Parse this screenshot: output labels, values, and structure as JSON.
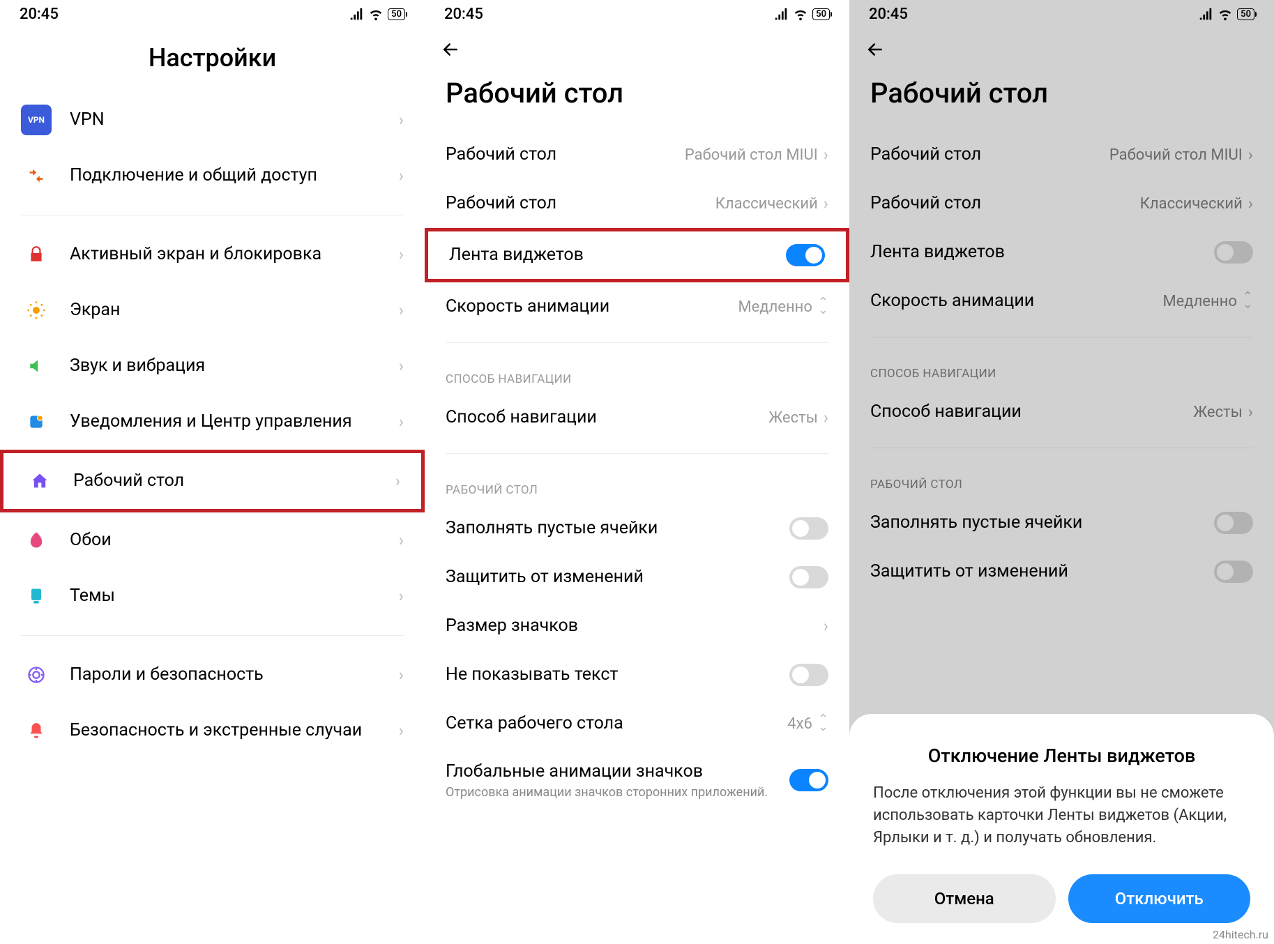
{
  "status": {
    "time": "20:45",
    "battery": "50"
  },
  "screen1": {
    "title": "Настройки",
    "items": [
      {
        "label": "VPN",
        "icon": "vpn"
      },
      {
        "label": "Подключение и общий доступ",
        "icon": "share"
      }
    ],
    "items2": [
      {
        "label": "Активный экран и блокировка",
        "icon": "lock"
      },
      {
        "label": "Экран",
        "icon": "sun"
      },
      {
        "label": "Звук и вибрация",
        "icon": "sound"
      },
      {
        "label": "Уведомления и Центр управления",
        "icon": "notif"
      },
      {
        "label": "Рабочий стол",
        "icon": "home",
        "highlight": true
      },
      {
        "label": "Обои",
        "icon": "wall"
      },
      {
        "label": "Темы",
        "icon": "theme"
      }
    ],
    "items3": [
      {
        "label": "Пароли и безопасность",
        "icon": "pass"
      },
      {
        "label": "Безопасность и экстренные случаи",
        "icon": "alert"
      }
    ]
  },
  "screen2": {
    "title": "Рабочий стол",
    "rows_top": [
      {
        "label": "Рабочий стол",
        "value": "Рабочий стол MIUI",
        "type": "link"
      },
      {
        "label": "Рабочий стол",
        "value": "Классический",
        "type": "link"
      },
      {
        "label": "Лента виджетов",
        "type": "toggle",
        "state": "on",
        "highlight": true
      },
      {
        "label": "Скорость анимации",
        "value": "Медленно",
        "type": "select"
      }
    ],
    "sec_nav_title": "СПОСОБ НАВИГАЦИИ",
    "rows_nav": [
      {
        "label": "Способ навигации",
        "value": "Жесты",
        "type": "link"
      }
    ],
    "sec_desk_title": "РАБОЧИЙ СТОЛ",
    "rows_desk": [
      {
        "label": "Заполнять пустые ячейки",
        "type": "toggle",
        "state": "off"
      },
      {
        "label": "Защитить от изменений",
        "type": "toggle",
        "state": "off"
      },
      {
        "label": "Размер значков",
        "type": "link"
      },
      {
        "label": "Не показывать текст",
        "type": "toggle",
        "state": "off"
      },
      {
        "label": "Сетка рабочего стола",
        "value": "4x6",
        "type": "select"
      },
      {
        "label": "Глобальные анимации значков",
        "sub": "Отрисовка анимации значков сторонних приложений.",
        "type": "toggle",
        "state": "on"
      }
    ]
  },
  "screen3": {
    "title": "Рабочий стол",
    "rows_top": [
      {
        "label": "Рабочий стол",
        "value": "Рабочий стол MIUI",
        "type": "link"
      },
      {
        "label": "Рабочий стол",
        "value": "Классический",
        "type": "link"
      },
      {
        "label": "Лента виджетов",
        "type": "toggle",
        "state": "off"
      },
      {
        "label": "Скорость анимации",
        "value": "Медленно",
        "type": "select"
      }
    ],
    "sec_nav_title": "СПОСОБ НАВИГАЦИИ",
    "rows_nav": [
      {
        "label": "Способ навигации",
        "value": "Жесты",
        "type": "link"
      }
    ],
    "sec_desk_title": "РАБОЧИЙ СТОЛ",
    "rows_desk": [
      {
        "label": "Заполнять пустые ячейки",
        "type": "toggle",
        "state": "off"
      },
      {
        "label": "Защитить от изменений",
        "type": "toggle",
        "state": "off"
      }
    ],
    "dialog": {
      "title": "Отключение Ленты виджетов",
      "body": "После отключения этой функции вы не сможете использовать карточки Ленты виджетов (Акции, Ярлыки и т. д.) и получать обновления.",
      "cancel": "Отмена",
      "confirm": "Отключить"
    }
  },
  "attribution": "24hitech.ru"
}
